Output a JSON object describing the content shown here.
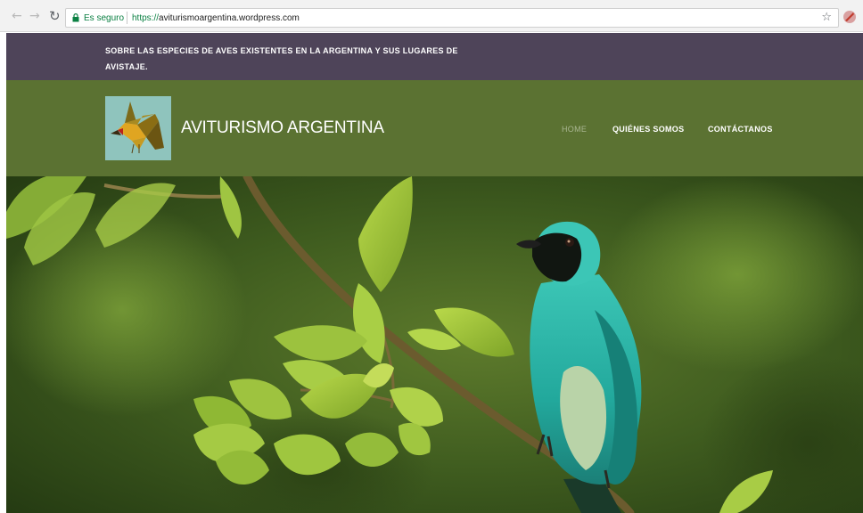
{
  "browser": {
    "secure_label": "Es seguro",
    "url_scheme": "https://",
    "url_host": "aviturismoargentina.wordpress.com",
    "icons": [
      "back-arrow-icon",
      "forward-arrow-icon",
      "reload-icon",
      "lock-icon",
      "star-icon",
      "extension-icon"
    ],
    "colors": {
      "secure": "#0b8043",
      "toolbar": "#f2f2f2"
    }
  },
  "site": {
    "tagline": "SOBRE LAS ESPECIES DE AVES EXISTENTES EN LA ARGENTINA Y SUS LUGARES DE AVISTAJE.",
    "title": "AVITURISMO ARGENTINA",
    "logo_icon": "bird-logo-icon",
    "menu": [
      {
        "label": "HOME",
        "active": true
      },
      {
        "label": "QUIÉNES SOMOS",
        "active": false
      },
      {
        "label": "CONTÁCTANOS",
        "active": false
      }
    ],
    "colors": {
      "tagline_bar": "#4e4459",
      "header": "#5b7232",
      "logo_bg": "#8fc4bd"
    }
  },
  "hero": {
    "image": "turquoise-bird-on-branch",
    "colors": {
      "bird": "#2fb5a8",
      "leaves": "#9bc33a",
      "background": "#3c5a1e"
    }
  }
}
